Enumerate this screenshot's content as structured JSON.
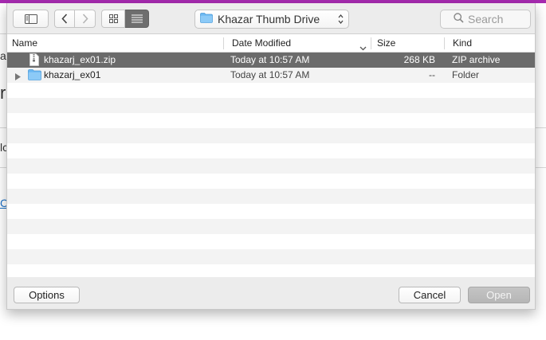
{
  "background": {
    "fragments": [
      "a",
      "r",
      "lc",
      "C"
    ]
  },
  "toolbar": {
    "sidebar_toggle_icon": "sidebar-icon",
    "back_icon": "chevron-left-icon",
    "forward_icon": "chevron-right-icon",
    "view_icons": [
      "icon-view-icon",
      "list-view-icon"
    ],
    "active_view": "list"
  },
  "location": {
    "label": "Khazar Thumb Drive",
    "icon": "folder-icon"
  },
  "search": {
    "placeholder": "Search"
  },
  "columns": {
    "name": "Name",
    "date_modified": "Date Modified",
    "size": "Size",
    "kind": "Kind"
  },
  "files": [
    {
      "name": "khazarj_ex01.zip",
      "date": "Today at 10:57 AM",
      "size": "268 KB",
      "kind": "ZIP archive",
      "icon": "zip-file-icon",
      "selected": true
    },
    {
      "name": "khazarj_ex01",
      "date": "Today at 10:57 AM",
      "size": "--",
      "kind": "Folder",
      "icon": "folder-icon",
      "selected": false
    }
  ],
  "footer": {
    "options_label": "Options",
    "cancel_label": "Cancel",
    "open_label": "Open"
  },
  "colors": {
    "accent_bar": "#a62bb0",
    "selection": "#6b6b6b",
    "folder": "#5aaef0"
  }
}
